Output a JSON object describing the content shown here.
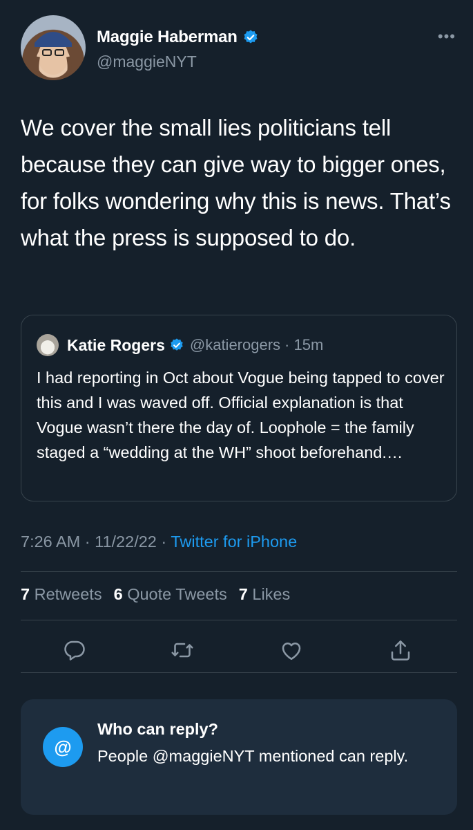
{
  "author": {
    "name": "Maggie Haberman",
    "handle": "@maggieNYT",
    "verified": true
  },
  "more_label": "•••",
  "tweet": {
    "text": "We cover the small lies politicians tell because they can give way to bigger ones, for folks wondering why this is news. That’s what the press is supposed to do."
  },
  "quote": {
    "name": "Katie Rogers",
    "handle": "@katierogers",
    "time": "· 15m",
    "text": "I had reporting in Oct about Vogue being tapped to cover this and I was waved off. Official explanation is that Vogue wasn’t there the day of. Loophole = the family staged a “wedding at the WH” shoot beforehand.…"
  },
  "meta": {
    "time": "7:26 AM",
    "date": "11/22/22",
    "source": "Twitter for iPhone"
  },
  "stats": {
    "retweets_count": "7",
    "retweets_label": "Retweets",
    "quotes_count": "6",
    "quotes_label": "Quote Tweets",
    "likes_count": "7",
    "likes_label": "Likes"
  },
  "actions": {
    "icons": [
      "reply-icon",
      "retweet-icon",
      "like-icon",
      "share-icon"
    ]
  },
  "who_can_reply": {
    "symbol": "@",
    "title": "Who can reply?",
    "description": "People @maggieNYT mentioned can reply."
  },
  "colors": {
    "background": "#15202b",
    "accent": "#1d9bf0",
    "secondary_text": "#8b98a5",
    "border": "#38444d",
    "reply_box": "#1e2d3d"
  }
}
